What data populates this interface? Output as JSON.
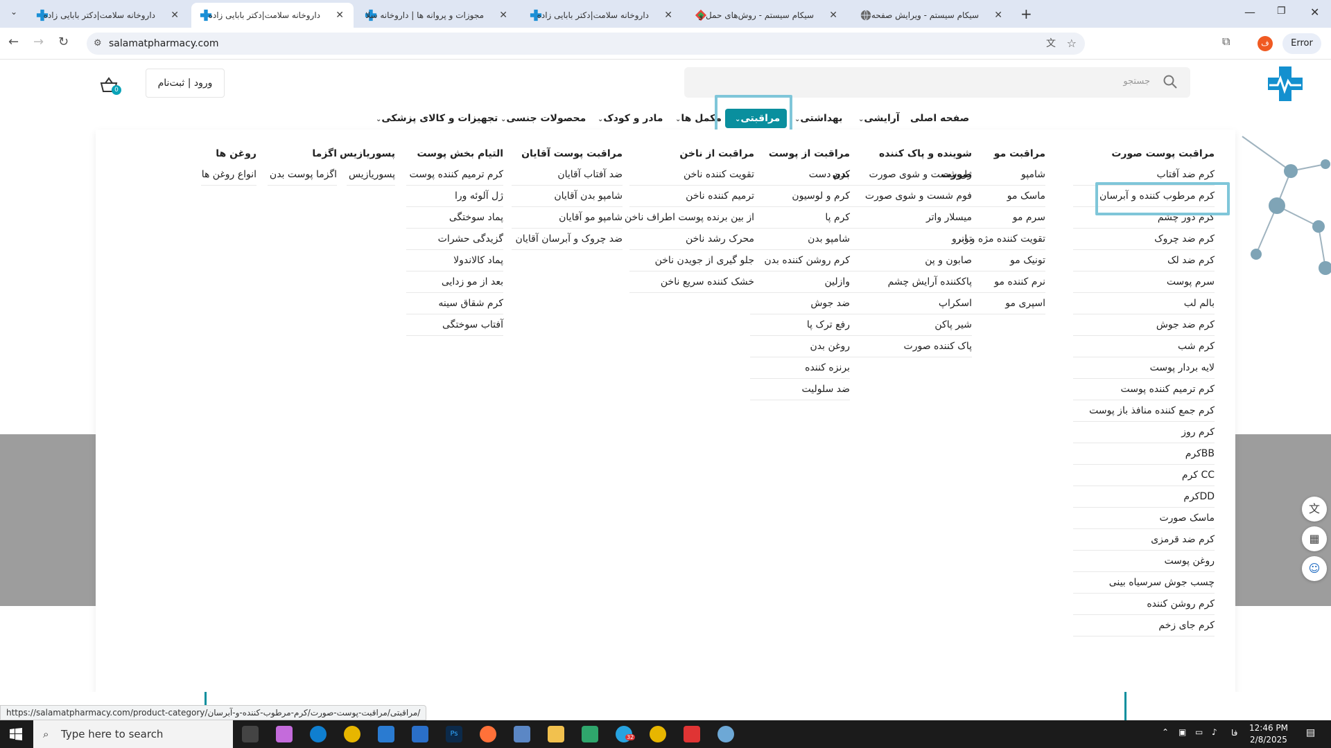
{
  "browser": {
    "tabs": [
      {
        "title": "داروخانه سلامت|دکتر بابایی زاده",
        "active": false
      },
      {
        "title": "داروخانه سلامت|دکتر بابایی زاده",
        "active": true
      },
      {
        "title": "مجوزات و پروانه ها | داروخانه سلا",
        "active": false
      },
      {
        "title": "داروخانه سلامت|دکتر بابایی زاده",
        "active": false
      },
      {
        "title": "سیکام سیستم - روش‌های حمل و",
        "active": false
      },
      {
        "title": "سیکام سیستم - ویرایش صفحه",
        "active": false
      }
    ],
    "url": "salamatpharmacy.com",
    "profile_label": "Error",
    "profile_initial": "ف"
  },
  "header": {
    "search_placeholder": "جستجو",
    "login_label": "ورود | ثبت‌نام",
    "cart_count": "0"
  },
  "nav": {
    "items": [
      {
        "label": "صفحه اصلی",
        "chevron": false
      },
      {
        "label": "آرایشی",
        "chevron": true
      },
      {
        "label": "بهداشتی",
        "chevron": true
      },
      {
        "label": "مراقبتی",
        "chevron": true,
        "active": true
      },
      {
        "label": "مکمل ها",
        "chevron": true
      },
      {
        "label": "مادر و کودک",
        "chevron": true
      },
      {
        "label": "محصولات جنسی",
        "chevron": true
      },
      {
        "label": "تجهیزات و کالای پزشکی",
        "chevron": true
      }
    ]
  },
  "mega_menu": {
    "columns": [
      {
        "title": "مراقبت پوست صورت",
        "items": [
          "کرم ضد آفتاب",
          "کرم مرطوب کننده و آبرسان",
          "کرم دور چشم",
          "کرم ضد چروک",
          "کرم ضد لک",
          "سرم پوست",
          "بالم لب",
          "کرم ضد جوش",
          "کرم شب",
          "لایه بردار پوست",
          "کرم ترمیم کننده پوست",
          "کرم جمع کننده منافذ باز پوست",
          "کرم روز",
          "BBکرم",
          "CC کرم",
          "DDکرم",
          "ماسک صورت",
          "کرم ضد قرمزی",
          "روغن پوست",
          "چسب جوش سرسیاه بینی",
          "کرم روشن کننده",
          "کرم جای زخم"
        ]
      },
      {
        "title": "مراقبت مو",
        "items": [
          "شامپو",
          "ماسک مو",
          "سرم مو",
          "تقویت کننده مژه و ابرو",
          "تونیک مو",
          "نرم کننده مو",
          "اسپری مو"
        ]
      },
      {
        "title": "شوینده و پاک کننده صورت",
        "items": [
          "ژل شست و شوی صورت",
          "فوم شست و شوی صورت",
          "میسلار واتر",
          "تونر",
          "صابون و پن",
          "پاککننده آرایش چشم",
          "اسکراپ",
          "شیر پاکن",
          "پاک کننده صورت"
        ]
      },
      {
        "title": "مراقبت از پوست بدن",
        "items": [
          "کرم دست",
          "کرم و لوسیون",
          "کرم پا",
          "شامپو بدن",
          "کرم روشن کننده بدن",
          "وازلین",
          "ضد جوش",
          "رفع ترک پا",
          "روغن بدن",
          "برنزه کننده",
          "ضد سلولیت"
        ]
      },
      {
        "title": "مراقبت از ناخن",
        "items": [
          "تقویت کننده ناخن",
          "ترمیم کننده ناخن",
          "از بین برنده پوست اطراف ناخن",
          "محرک رشد ناخن",
          "جلو گیری از جویدن ناخن",
          "خشک کننده سریع ناخن"
        ]
      },
      {
        "title": "مراقبت پوست آقایان",
        "items": [
          "ضد آفتاب آقایان",
          "شامپو بدن آقایان",
          "شامپو مو آقایان",
          "ضد چروک و آبرسان آقایان"
        ]
      },
      {
        "title": "التیام بخش پوست",
        "items": [
          "کرم ترمیم کننده پوست",
          "ژل آلوئه ورا",
          "پماد سوختگی",
          "گزیدگی حشرات",
          "پماد کالاندولا",
          "بعد از مو زدایی",
          "کرم شقاق سینه",
          "آفتاب سوختگی"
        ]
      },
      {
        "title": "پسوریازیس",
        "items": [
          "پسوریازیس"
        ]
      },
      {
        "title": "اگزما",
        "items": [
          "اگزما پوست بدن"
        ]
      },
      {
        "title": "روغن ها",
        "items": [
          "انواع روغن ها"
        ]
      }
    ]
  },
  "status_url": "https://salamatpharmacy.com/product-category/مراقبتی/مراقبت-پوست-صورت/کرم-مرطوب-کننده-و-آبرسان/",
  "taskbar": {
    "search_placeholder": "Type here to search",
    "time": "12:46 PM",
    "date": "2/8/2025",
    "lang": "فا",
    "telegram_badge": "32"
  },
  "colors": {
    "accent": "#0a8f9e",
    "highlight": "#7fc6d9",
    "tabbar": "#dfe6f3"
  }
}
